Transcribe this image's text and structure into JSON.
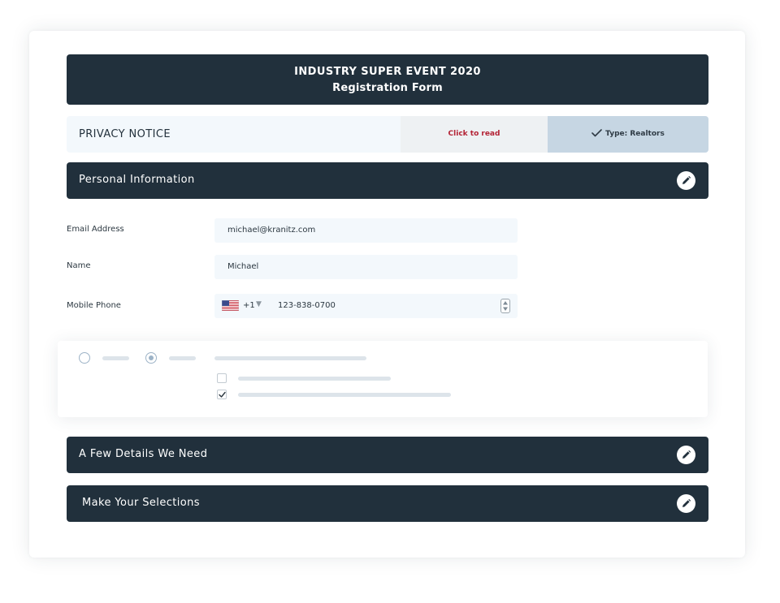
{
  "form": {
    "event_title": "INDUSTRY SUPER EVENT 2020",
    "subtitle": "Registration Form"
  },
  "privacy": {
    "label": "PRIVACY NOTICE",
    "read_link": "Click to read",
    "type_text": "Type: Realtors",
    "type_icon": "checkmark-icon"
  },
  "sections": {
    "personal": "Personal Information",
    "details": "A Few Details We Need",
    "selections": "Make Your Selections",
    "edit_icon": "pencil-icon"
  },
  "fields": {
    "email": {
      "label": "Email Address",
      "value": "michael@kranitz.com"
    },
    "name": {
      "label": "Name",
      "value": "Michael"
    },
    "phone": {
      "label": "Mobile Phone",
      "country_flag": "us-flag-icon",
      "country_code": "+1",
      "caret": "▼",
      "value": "123-838-0700"
    }
  },
  "options": {
    "radio_1_checked": false,
    "radio_2_checked": true,
    "checkbox_1_checked": false,
    "checkbox_2_checked": true
  },
  "colors": {
    "dark_navy": "#21303c",
    "input_bg": "#f3f8fc",
    "link_red": "#b32234",
    "type_bg": "#c6d6e3"
  }
}
